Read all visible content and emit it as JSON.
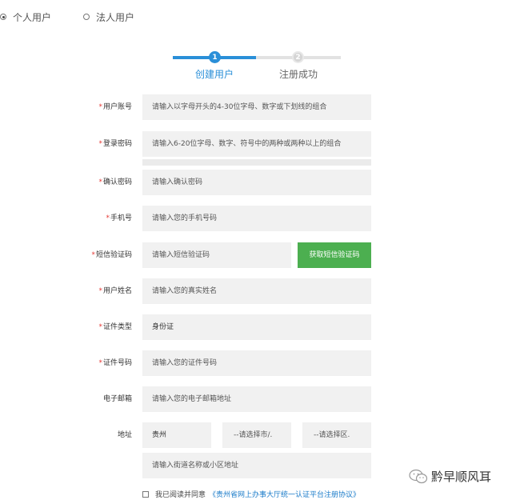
{
  "user_type": {
    "options": [
      {
        "label": "个人用户",
        "selected": true
      },
      {
        "label": "法人用户",
        "selected": false
      }
    ]
  },
  "steps": [
    {
      "number": "1",
      "label": "创建用户",
      "active": true
    },
    {
      "number": "2",
      "label": "注册成功",
      "active": false
    }
  ],
  "form": {
    "username": {
      "label": "用户账号",
      "required": true,
      "placeholder": "请输入以字母开头的4-30位字母、数字或下划线的组合"
    },
    "password": {
      "label": "登录密码",
      "required": true,
      "placeholder": "请输入6-20位字母、数字、符号中的两种或两种以上的组合"
    },
    "confirm_password": {
      "label": "确认密码",
      "required": true,
      "placeholder": "请输入确认密码"
    },
    "phone": {
      "label": "手机号",
      "required": true,
      "placeholder": "请输入您的手机号码"
    },
    "sms_code": {
      "label": "短信验证码",
      "required": true,
      "placeholder": "请输入短信验证码",
      "button": "获取短信验证码"
    },
    "real_name": {
      "label": "用户姓名",
      "required": true,
      "placeholder": "请输入您的真实姓名"
    },
    "id_type": {
      "label": "证件类型",
      "required": true,
      "value": "身份证"
    },
    "id_number": {
      "label": "证件号码",
      "required": true,
      "placeholder": "请输入您的证件号码"
    },
    "email": {
      "label": "电子邮箱",
      "required": false,
      "placeholder": "请输入您的电子邮箱地址"
    },
    "address": {
      "label": "地址",
      "required": false,
      "province": "贵州",
      "city": "--请选择市/.",
      "district": "--请选择区.",
      "street_placeholder": "请输入街道名称或小区地址"
    }
  },
  "agreement": {
    "text": "我已阅读并同意",
    "link": "《贵州省网上办事大厅统一认证平台注册协议》"
  },
  "watermark": {
    "text": "黔早顺风耳"
  },
  "colors": {
    "accent": "#2a8fd8",
    "button_green": "#4caf50",
    "required": "#e53935",
    "field_bg": "#f1f1f1"
  }
}
